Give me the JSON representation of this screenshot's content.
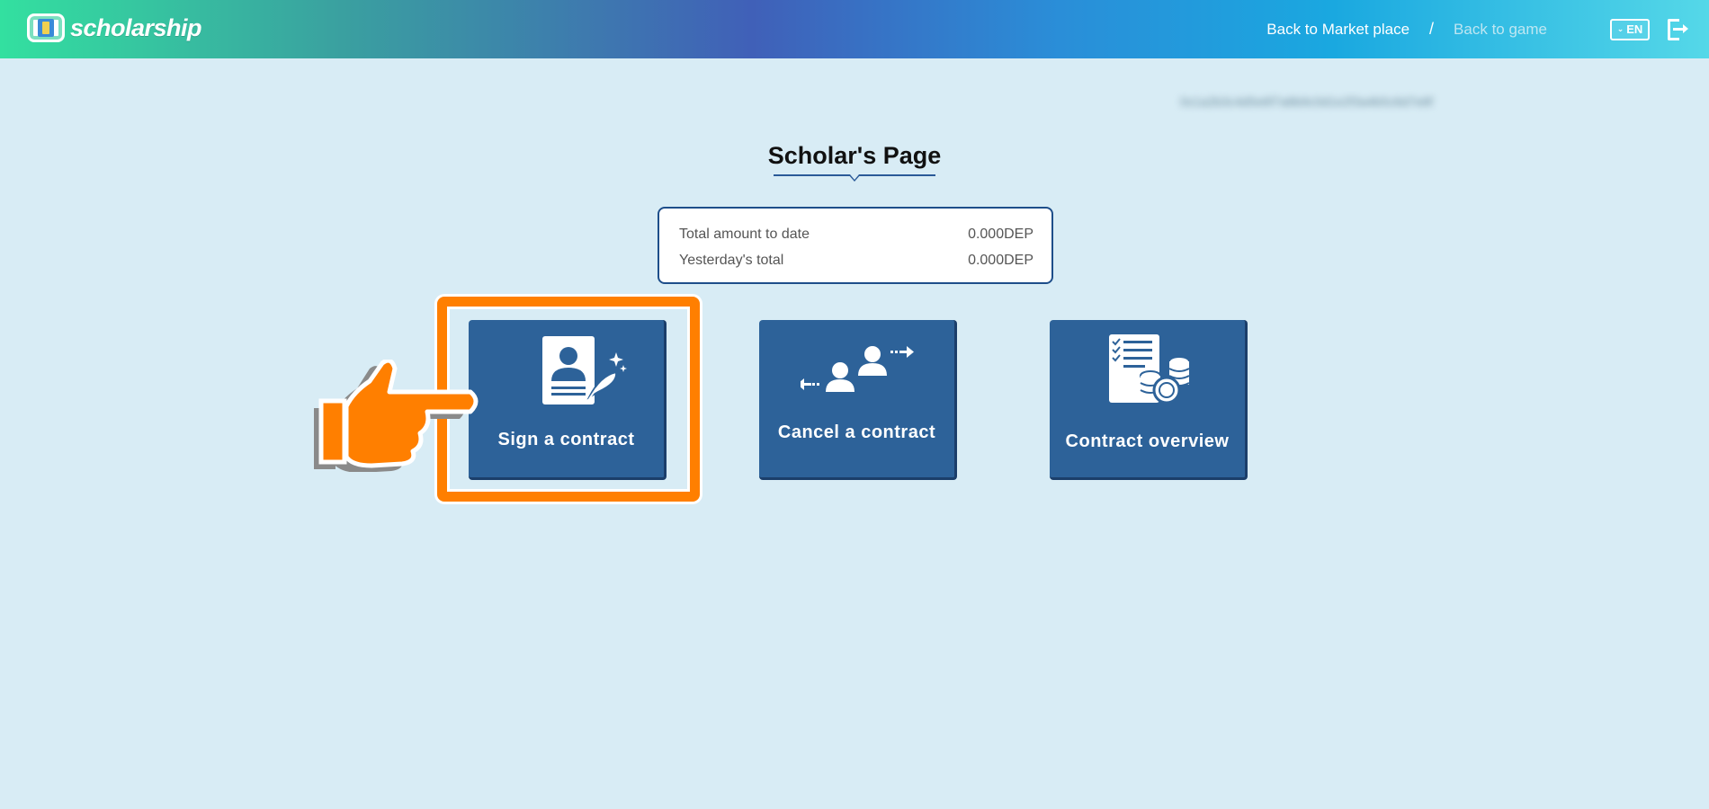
{
  "header": {
    "logo_text": "scholarship",
    "nav": {
      "market": "Back to Market place",
      "separator": "/",
      "game": "Back to game"
    },
    "lang": "EN"
  },
  "blurred_text": "0x1a2b3c4d5e6f7a8b9c0d1e2f3a4b5c6d7e8f",
  "page_title": "Scholar's Page",
  "summary": {
    "rows": [
      {
        "label": "Total amount to date",
        "value": "0.000DEP"
      },
      {
        "label": "Yesterday's total",
        "value": "0.000DEP"
      }
    ]
  },
  "cards": {
    "sign": "Sign a contract",
    "cancel": "Cancel a contract",
    "overview": "Contract overview"
  },
  "colors": {
    "accent_orange": "#ff7f00",
    "card_blue": "#2d6299",
    "background": "#d8ecf5"
  },
  "icons": {
    "sign": "contract-sign-icon",
    "cancel": "user-swap-icon",
    "overview": "document-coins-icon",
    "pointer": "pointing-hand-icon"
  }
}
